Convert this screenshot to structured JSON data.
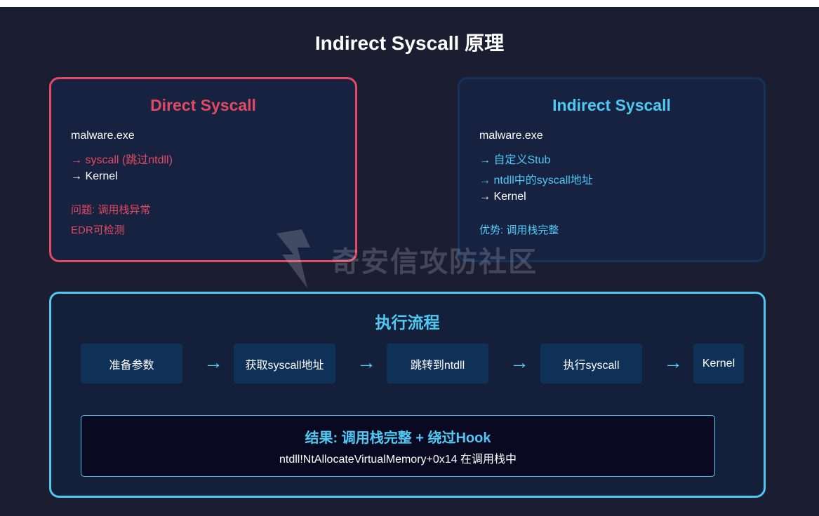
{
  "title": "Indirect Syscall 原理",
  "direct": {
    "title": "Direct Syscall",
    "lines": [
      "malware.exe",
      "→ syscall (跳过ntdll)",
      "→ Kernel"
    ],
    "problems": [
      "问题: 调用栈异常",
      "EDR可检测"
    ]
  },
  "indirect": {
    "title": "Indirect Syscall",
    "lines": [
      "malware.exe",
      "→ 自定义Stub",
      "→ ntdll中的syscall地址",
      "→ Kernel"
    ],
    "advantage": "优势: 调用栈完整"
  },
  "watermark": {
    "text": "奇安信攻防社区"
  },
  "flow": {
    "title": "执行流程",
    "steps": [
      "准备参数",
      "获取syscall地址",
      "跳转到ntdll",
      "执行syscall",
      "Kernel"
    ],
    "arrow": "→",
    "result_title": "结果: 调用栈完整 + 绕过Hook",
    "result_detail": "ntdll!NtAllocateVirtualMemory+0x14 在调用栈中"
  },
  "colors": {
    "background": "#1b1d31",
    "direct_accent": "#e24a63",
    "indirect_accent": "#4fc9f4",
    "panel_fill": "#16223f",
    "step_fill": "#0f3157",
    "result_fill": "#090a22"
  }
}
